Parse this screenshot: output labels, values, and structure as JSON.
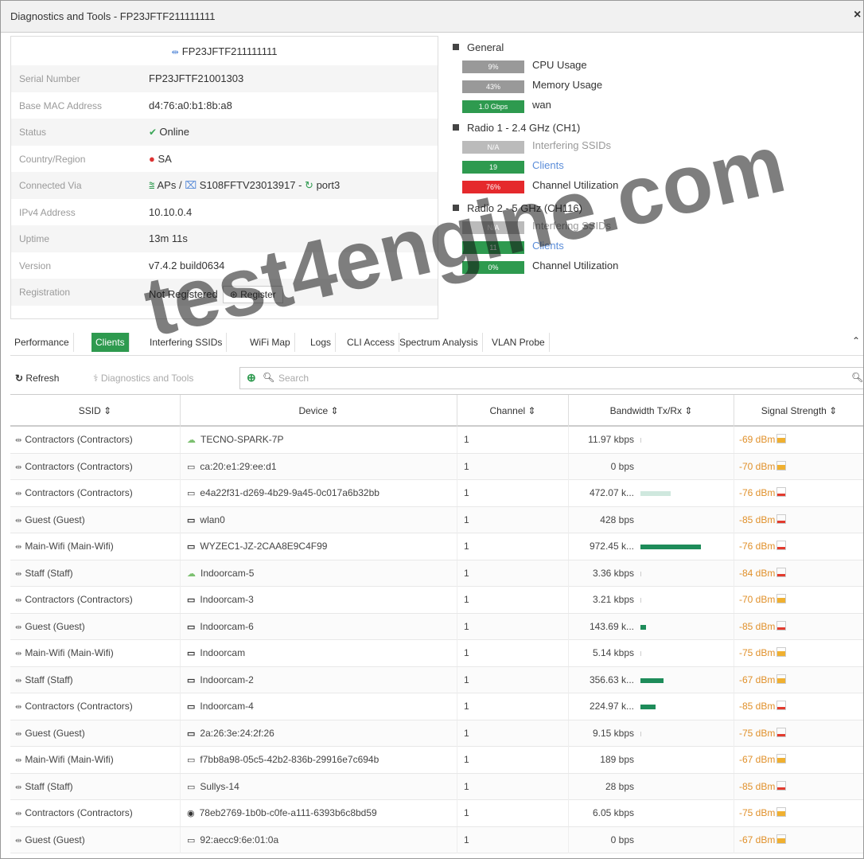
{
  "window": {
    "title": "Diagnostics and Tools - FP23JFTF211111111",
    "close": "×"
  },
  "device": {
    "header_name": "FP23JFTF211111111",
    "fields": [
      {
        "label": "Serial Number",
        "value": "FP23JFTF21001303"
      },
      {
        "label": "Base MAC Address",
        "value": "d4:76:a0:b1:8b:a8"
      },
      {
        "label": "Status",
        "value": "Online",
        "icon": "check-circle-icon",
        "icon_color": "#3aa657"
      },
      {
        "label": "Country/Region",
        "value": "SA",
        "icon": "alert-circle-icon",
        "icon_color": "#dd3333"
      },
      {
        "label": "Connected Via",
        "aps": "APs",
        "switch": "S108FFTV23013917",
        "port": "port3"
      },
      {
        "label": "IPv4 Address",
        "value": "10.10.0.4"
      },
      {
        "label": "Uptime",
        "value": "13m 11s"
      },
      {
        "label": "Version",
        "value": "v7.4.2 build0634"
      },
      {
        "label": "Registration",
        "value": "Not Registered",
        "button": "Register"
      }
    ]
  },
  "general": {
    "title": "General",
    "metrics": [
      {
        "badge": "9%",
        "label": "CPU Usage"
      },
      {
        "badge": "43%",
        "label": "Memory Usage"
      },
      {
        "badge": "1.0 Gbps",
        "label": "wan"
      }
    ]
  },
  "radio1": {
    "title": "Radio 1 - 2.4 GHz (CH1)",
    "metrics": [
      {
        "badge": "N/A",
        "label": "Interfering SSIDs"
      },
      {
        "badge": "19",
        "label": "Clients"
      },
      {
        "badge": "76%",
        "label": "Channel Utilization"
      }
    ]
  },
  "radio2": {
    "title": "Radio 2 - 5 GHz (CH116)",
    "metrics": [
      {
        "badge": "N/A",
        "label": "Interfering SSIDs"
      },
      {
        "badge": "11",
        "label": "Clients"
      },
      {
        "badge": "0%",
        "label": "Channel Utilization"
      }
    ]
  },
  "tabs": [
    "Performance",
    "Clients",
    "Interfering SSIDs",
    "WiFi Map",
    "Logs",
    "CLI Access",
    "Spectrum Analysis",
    "VLAN Probe"
  ],
  "active_tab": "Clients",
  "toolbar": {
    "refresh": "Refresh",
    "diagnostics": "Diagnostics and Tools",
    "search_placeholder": "Search"
  },
  "columns": [
    "SSID ⇕",
    "Device ⇕",
    "Channel ⇕",
    "Bandwidth Tx/Rx ⇕",
    "Signal Strength ⇕"
  ],
  "rows": [
    {
      "ssid": "Contractors (Contractors)",
      "device_icon": "android-icon",
      "device": "TECNO-SPARK-7P",
      "channel": "1",
      "bandwidth": "11.97 kbps",
      "bw_bar": 0.01,
      "signal": "-69 dBm",
      "signal_level": "orange"
    },
    {
      "ssid": "Contractors (Contractors)",
      "device_icon": "apple-icon",
      "device": "ca:20:e1:29:ee:d1",
      "channel": "1",
      "bandwidth": "0 bps",
      "bw_bar": 0,
      "signal": "-70 dBm",
      "signal_level": "orange"
    },
    {
      "ssid": "Contractors (Contractors)",
      "device_icon": "apple-icon",
      "device": "e4a22f31-d269-4b29-9a45-0c017a6b32bb",
      "channel": "1",
      "bandwidth": "472.07 k...",
      "bw_bar": 0.45,
      "bw_light": true,
      "signal": "-76 dBm",
      "signal_level": "red"
    },
    {
      "ssid": "Guest (Guest)",
      "device_icon": "monitor-icon",
      "device": "wlan0",
      "channel": "1",
      "bandwidth": "428 bps",
      "bw_bar": 0,
      "signal": "-85 dBm",
      "signal_level": "red"
    },
    {
      "ssid": "Main-Wifi (Main-Wifi)",
      "device_icon": "monitor-icon",
      "device": "WYZEC1-JZ-2CAA8E9C4F99",
      "channel": "1",
      "bandwidth": "972.45 k...",
      "bw_bar": 0.9,
      "signal": "-76 dBm",
      "signal_level": "red"
    },
    {
      "ssid": "Staff (Staff)",
      "device_icon": "android-icon",
      "device": "Indoorcam-5",
      "channel": "1",
      "bandwidth": "3.36 kbps",
      "bw_bar": 0.01,
      "signal": "-84 dBm",
      "signal_level": "red"
    },
    {
      "ssid": "Contractors (Contractors)",
      "device_icon": "monitor-icon",
      "device": "Indoorcam-3",
      "channel": "1",
      "bandwidth": "3.21 kbps",
      "bw_bar": 0.01,
      "signal": "-70 dBm",
      "signal_level": "orange"
    },
    {
      "ssid": "Guest (Guest)",
      "device_icon": "monitor-icon",
      "device": "Indoorcam-6",
      "channel": "1",
      "bandwidth": "143.69 k...",
      "bw_bar": 0.08,
      "signal": "-85 dBm",
      "signal_level": "red"
    },
    {
      "ssid": "Main-Wifi (Main-Wifi)",
      "device_icon": "monitor-icon",
      "device": "Indoorcam",
      "channel": "1",
      "bandwidth": "5.14 kbps",
      "bw_bar": 0.01,
      "signal": "-75 dBm",
      "signal_level": "orange"
    },
    {
      "ssid": "Staff (Staff)",
      "device_icon": "monitor-icon",
      "device": "Indoorcam-2",
      "channel": "1",
      "bandwidth": "356.63 k...",
      "bw_bar": 0.35,
      "signal": "-67 dBm",
      "signal_level": "orange"
    },
    {
      "ssid": "Contractors (Contractors)",
      "device_icon": "monitor-icon",
      "device": "Indoorcam-4",
      "channel": "1",
      "bandwidth": "224.97 k...",
      "bw_bar": 0.23,
      "signal": "-85 dBm",
      "signal_level": "red"
    },
    {
      "ssid": "Guest (Guest)",
      "device_icon": "monitor-icon",
      "device": "2a:26:3e:24:2f:26",
      "channel": "1",
      "bandwidth": "9.15 kbps",
      "bw_bar": 0.01,
      "signal": "-75 dBm",
      "signal_level": "red"
    },
    {
      "ssid": "Main-Wifi (Main-Wifi)",
      "device_icon": "apple-icon",
      "device": "f7bb8a98-05c5-42b2-836b-29916e7c694b",
      "channel": "1",
      "bandwidth": "189 bps",
      "bw_bar": 0,
      "signal": "-67 dBm",
      "signal_level": "orange"
    },
    {
      "ssid": "Staff (Staff)",
      "device_icon": "apple-icon",
      "device": "Sullys-14",
      "channel": "1",
      "bandwidth": "28 bps",
      "bw_bar": 0,
      "signal": "-85 dBm",
      "signal_level": "red"
    },
    {
      "ssid": "Contractors (Contractors)",
      "device_icon": "chrome-icon",
      "device": "78eb2769-1b0b-c0fe-a111-6393b6c8bd59",
      "channel": "1",
      "bandwidth": "6.05 kbps",
      "bw_bar": 0,
      "signal": "-75 dBm",
      "signal_level": "orange"
    },
    {
      "ssid": "Guest (Guest)",
      "device_icon": "apple-icon",
      "device": "92:aecc9:6e:01:0a",
      "channel": "1",
      "bandwidth": "0 bps",
      "bw_bar": 0,
      "signal": "-67 dBm",
      "signal_level": "orange"
    }
  ],
  "watermark": "test4engine.com"
}
